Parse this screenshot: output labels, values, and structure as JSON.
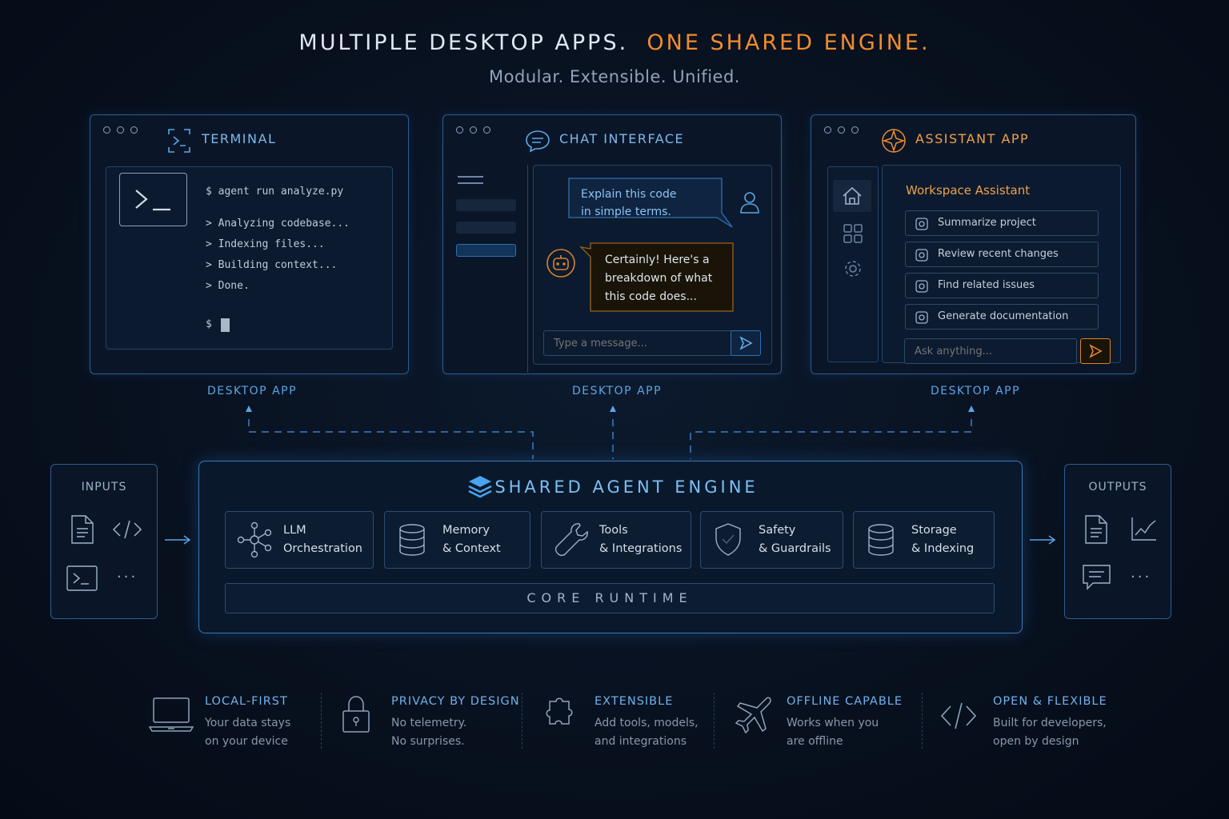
{
  "header": {
    "title_main": "MULTIPLE DESKTOP APPS.",
    "title_accent": "ONE SHARED ENGINE.",
    "subtitle": "Modular. Extensible. Unified."
  },
  "terminal": {
    "title": "TERMINAL",
    "lines": [
      "$  agent run analyze.py",
      ">  Analyzing codebase...",
      ">  Indexing files...",
      ">  Building context...",
      ">  Done."
    ],
    "prompt": "$",
    "caption": "DESKTOP APP"
  },
  "chat": {
    "title": "CHAT INTERFACE",
    "user_line1": "Explain this code",
    "user_line2": "in simple terms.",
    "bot_line1": "Certainly! Here's a",
    "bot_line2": "breakdown of what",
    "bot_line3": "this code does...",
    "input_placeholder": "Type a message...",
    "caption": "DESKTOP APP"
  },
  "assistant": {
    "title": "ASSISTANT APP",
    "heading": "Workspace Assistant",
    "items": [
      "Summarize project",
      "Review recent changes",
      "Find related issues",
      "Generate documentation"
    ],
    "input_placeholder": "Ask anything...",
    "caption": "DESKTOP APP"
  },
  "inputs": {
    "title": "INPUTS"
  },
  "outputs": {
    "title": "OUTPUTS"
  },
  "engine": {
    "title": "SHARED AGENT ENGINE",
    "modules": [
      {
        "l1": "LLM",
        "l2": "Orchestration"
      },
      {
        "l1": "Memory",
        "l2": "& Context"
      },
      {
        "l1": "Tools",
        "l2": "& Integrations"
      },
      {
        "l1": "Safety",
        "l2": "& Guardrails"
      },
      {
        "l1": "Storage",
        "l2": "& Indexing"
      }
    ],
    "runtime": "CORE RUNTIME"
  },
  "features": [
    {
      "title": "LOCAL-FIRST",
      "l1": "Your data stays",
      "l2": "on your device"
    },
    {
      "title": "PRIVACY BY DESIGN",
      "l1": "No telemetry.",
      "l2": "No surprises."
    },
    {
      "title": "EXTENSIBLE",
      "l1": "Add tools, models,",
      "l2": "and integrations"
    },
    {
      "title": "OFFLINE CAPABLE",
      "l1": "Works when you",
      "l2": "are offline"
    },
    {
      "title": "OPEN & FLEXIBLE",
      "l1": "Built for developers,",
      "l2": "open by design"
    }
  ],
  "colors": {
    "accent_blue": "#5aa6e6",
    "accent_orange": "#f08c2e",
    "background": "#070f1d"
  }
}
